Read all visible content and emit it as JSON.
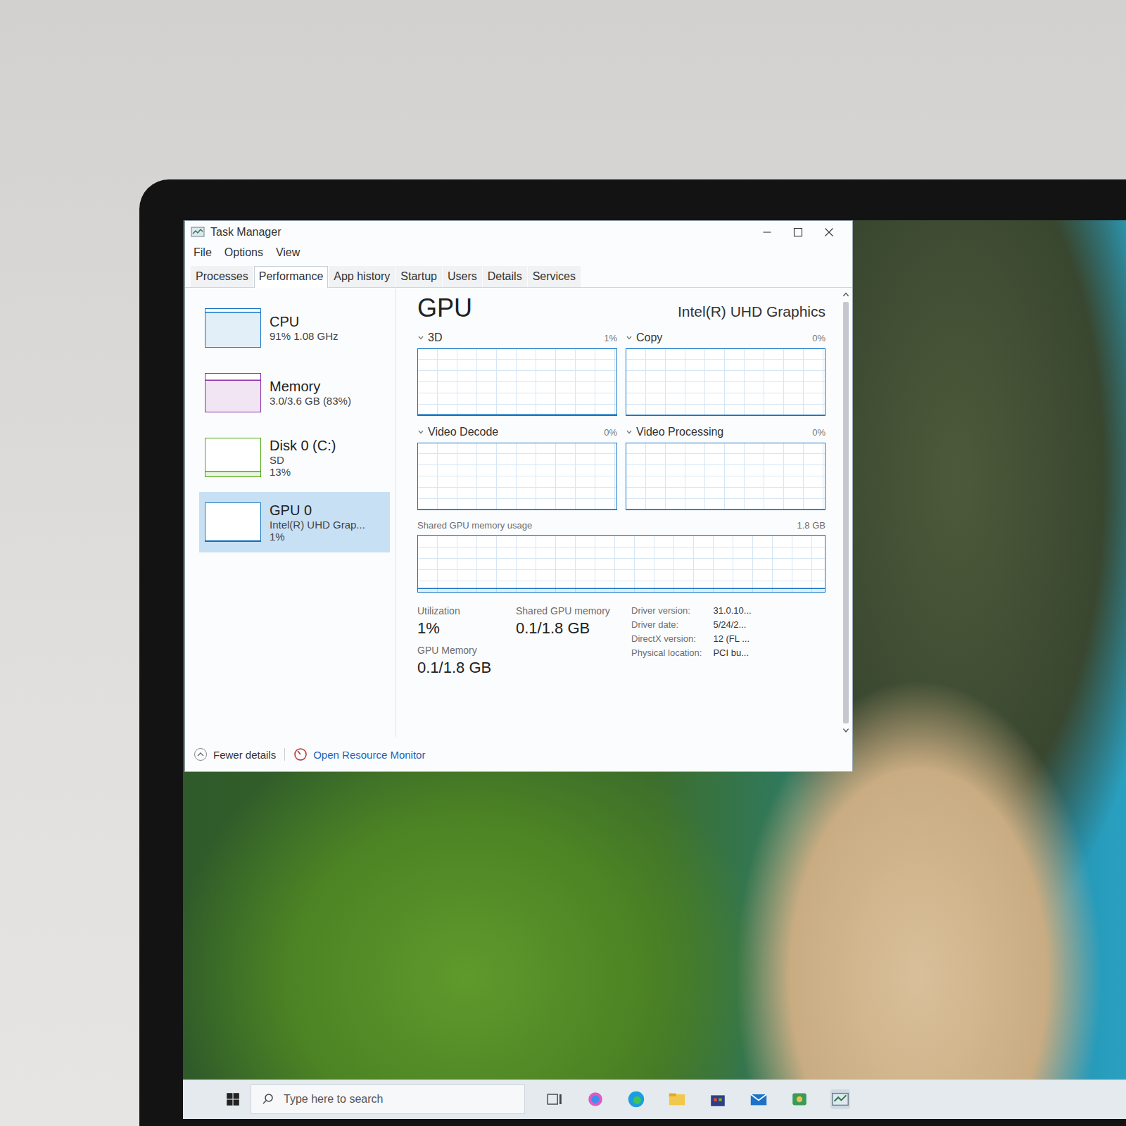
{
  "window": {
    "title": "Task Manager"
  },
  "menu": [
    "File",
    "Options",
    "View"
  ],
  "tabs": [
    {
      "label": "Processes",
      "selected": false
    },
    {
      "label": "Performance",
      "selected": true
    },
    {
      "label": "App history",
      "selected": false
    },
    {
      "label": "Startup",
      "selected": false
    },
    {
      "label": "Users",
      "selected": false
    },
    {
      "label": "Details",
      "selected": false
    },
    {
      "label": "Services",
      "selected": false
    }
  ],
  "sidebar": {
    "items": [
      {
        "name": "CPU",
        "lines": [
          "91% 1.08 GHz"
        ],
        "selected": false,
        "level": 0.91,
        "color": "#1174c4"
      },
      {
        "name": "Memory",
        "lines": [
          "3.0/3.6 GB (83%)"
        ],
        "selected": false,
        "level": 0.83,
        "color": "#8e2ca8"
      },
      {
        "name": "Disk 0 (C:)",
        "lines": [
          "SD",
          "13%"
        ],
        "selected": false,
        "level": 0.13,
        "color": "#4da60c"
      },
      {
        "name": "GPU 0",
        "lines": [
          "Intel(R) UHD Grap...",
          "1%"
        ],
        "selected": true,
        "level": 0.01,
        "color": "#1174c4"
      }
    ]
  },
  "panel": {
    "title": "GPU",
    "adapter": "Intel(R) UHD Graphics",
    "engines": [
      {
        "label": "3D",
        "reading": "1%",
        "level": 0.01
      },
      {
        "label": "Copy",
        "reading": "0%",
        "level": 0
      },
      {
        "label": "Video Decode",
        "reading": "0%",
        "level": 0
      },
      {
        "label": "Video Processing",
        "reading": "0%",
        "level": 0
      }
    ],
    "shared_chart": {
      "label": "Shared GPU memory usage",
      "max": "1.8 GB",
      "level": 0.06
    },
    "stats": [
      {
        "label": "Utilization",
        "value": "1%"
      },
      {
        "label": "Shared GPU memory",
        "value": "0.1/1.8 GB"
      },
      {
        "label": "GPU Memory",
        "value": "0.1/1.8 GB"
      }
    ],
    "details": [
      {
        "key": "Driver version:",
        "value": "31.0.10..."
      },
      {
        "key": "Driver date:",
        "value": "5/24/2..."
      },
      {
        "key": "DirectX version:",
        "value": "12 (FL ..."
      },
      {
        "key": "Physical location:",
        "value": "PCI bu..."
      }
    ]
  },
  "footer": {
    "fewer": "Fewer details",
    "monitor": "Open Resource Monitor"
  },
  "taskbar": {
    "search": {
      "placeholder": "Type here to search"
    }
  }
}
